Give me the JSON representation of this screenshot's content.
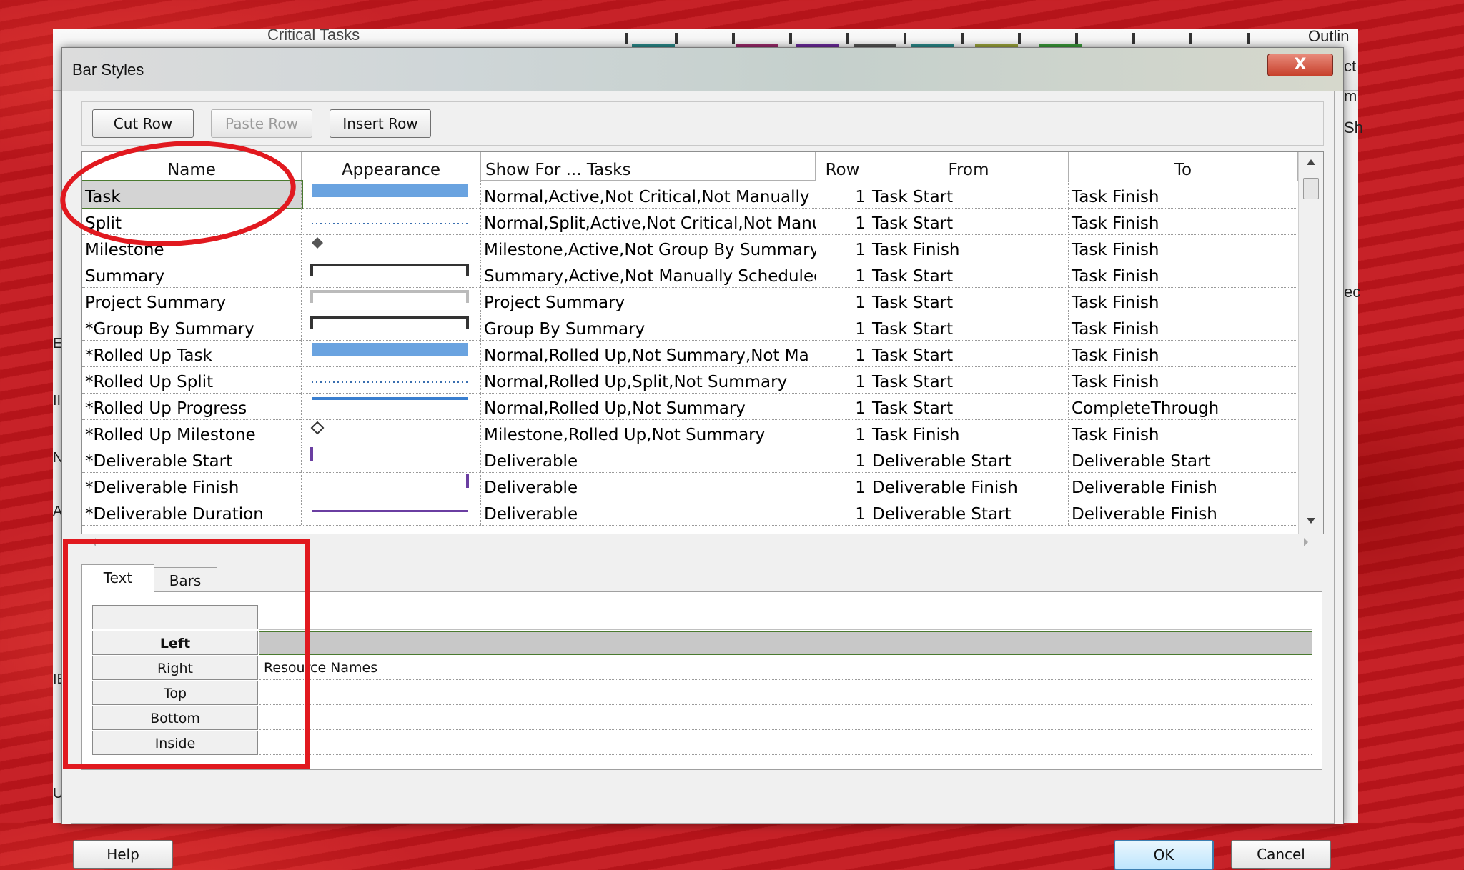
{
  "background_app": {
    "ribbon_labels": [
      "Critical Tasks"
    ],
    "right_fragments": [
      "Outlin",
      "ct",
      "m",
      "Sh",
      "ec"
    ],
    "left_fragments": [
      "E",
      "II",
      "N",
      "A",
      "IEF",
      "U"
    ]
  },
  "dialog": {
    "title": "Bar Styles",
    "close_label": "X",
    "toolbar": {
      "cut_row": "Cut Row",
      "paste_row": "Paste Row",
      "insert_row": "Insert Row"
    },
    "columns": {
      "name": "Name",
      "appearance": "Appearance",
      "show_for": "Show For ... Tasks",
      "row": "Row",
      "from": "From",
      "to": "To"
    },
    "rows": [
      {
        "name": "Task",
        "show_for": "Normal,Active,Not Critical,Not Manually S",
        "row": "1",
        "from": "Task Start",
        "to": "Task Finish",
        "appearance": "blue-bar"
      },
      {
        "name": "Split",
        "show_for": "Normal,Split,Active,Not Critical,Not Manu",
        "row": "1",
        "from": "Task Start",
        "to": "Task Finish",
        "appearance": "dotted-blue"
      },
      {
        "name": "Milestone",
        "show_for": "Milestone,Active,Not Group By Summary",
        "row": "1",
        "from": "Task Finish",
        "to": "Task Finish",
        "appearance": "diamond-filled"
      },
      {
        "name": "Summary",
        "show_for": "Summary,Active,Not Manually Scheduled",
        "row": "1",
        "from": "Task Start",
        "to": "Task Finish",
        "appearance": "summary-bracket-dark"
      },
      {
        "name": "Project Summary",
        "show_for": "Project Summary",
        "row": "1",
        "from": "Task Start",
        "to": "Task Finish",
        "appearance": "summary-bracket-light"
      },
      {
        "name": "*Group By Summary",
        "show_for": "Group By Summary",
        "row": "1",
        "from": "Task Start",
        "to": "Task Finish",
        "appearance": "summary-bracket-dark"
      },
      {
        "name": "*Rolled Up Task",
        "show_for": "Normal,Rolled Up,Not Summary,Not Ma",
        "row": "1",
        "from": "Task Start",
        "to": "Task Finish",
        "appearance": "blue-bar"
      },
      {
        "name": "*Rolled Up Split",
        "show_for": "Normal,Rolled Up,Split,Not Summary",
        "row": "1",
        "from": "Task Start",
        "to": "Task Finish",
        "appearance": "dotted-blue"
      },
      {
        "name": "*Rolled Up Progress",
        "show_for": "Normal,Rolled Up,Not Summary",
        "row": "1",
        "from": "Task Start",
        "to": "CompleteThrough",
        "appearance": "thin-blue-line"
      },
      {
        "name": "*Rolled Up Milestone",
        "show_for": "Milestone,Rolled Up,Not Summary",
        "row": "1",
        "from": "Task Finish",
        "to": "Task Finish",
        "appearance": "diamond-outline"
      },
      {
        "name": "*Deliverable Start",
        "show_for": "Deliverable",
        "row": "1",
        "from": "Deliverable Start",
        "to": "Deliverable Start",
        "appearance": "purple-tick-left"
      },
      {
        "name": "*Deliverable Finish",
        "show_for": "Deliverable",
        "row": "1",
        "from": "Deliverable Finish",
        "to": "Deliverable Finish",
        "appearance": "purple-tick-right"
      },
      {
        "name": "*Deliverable Duration",
        "show_for": "Deliverable",
        "row": "1",
        "from": "Deliverable Start",
        "to": "Deliverable Finish",
        "appearance": "purple-line"
      }
    ],
    "tabs": [
      "Text",
      "Bars"
    ],
    "text_positions": [
      {
        "label": "Left",
        "value": ""
      },
      {
        "label": "Right",
        "value": "Resource Names"
      },
      {
        "label": "Top",
        "value": ""
      },
      {
        "label": "Bottom",
        "value": ""
      },
      {
        "label": "Inside",
        "value": ""
      }
    ],
    "footer": {
      "help": "Help",
      "ok": "OK",
      "cancel": "Cancel"
    }
  },
  "colors": {
    "background_red": "#c4161c",
    "annotation_red": "#e1191f",
    "bar_blue": "#6aa3e0",
    "deliverable_purple": "#6a3ea1",
    "selection_green": "#4a7a2f"
  }
}
